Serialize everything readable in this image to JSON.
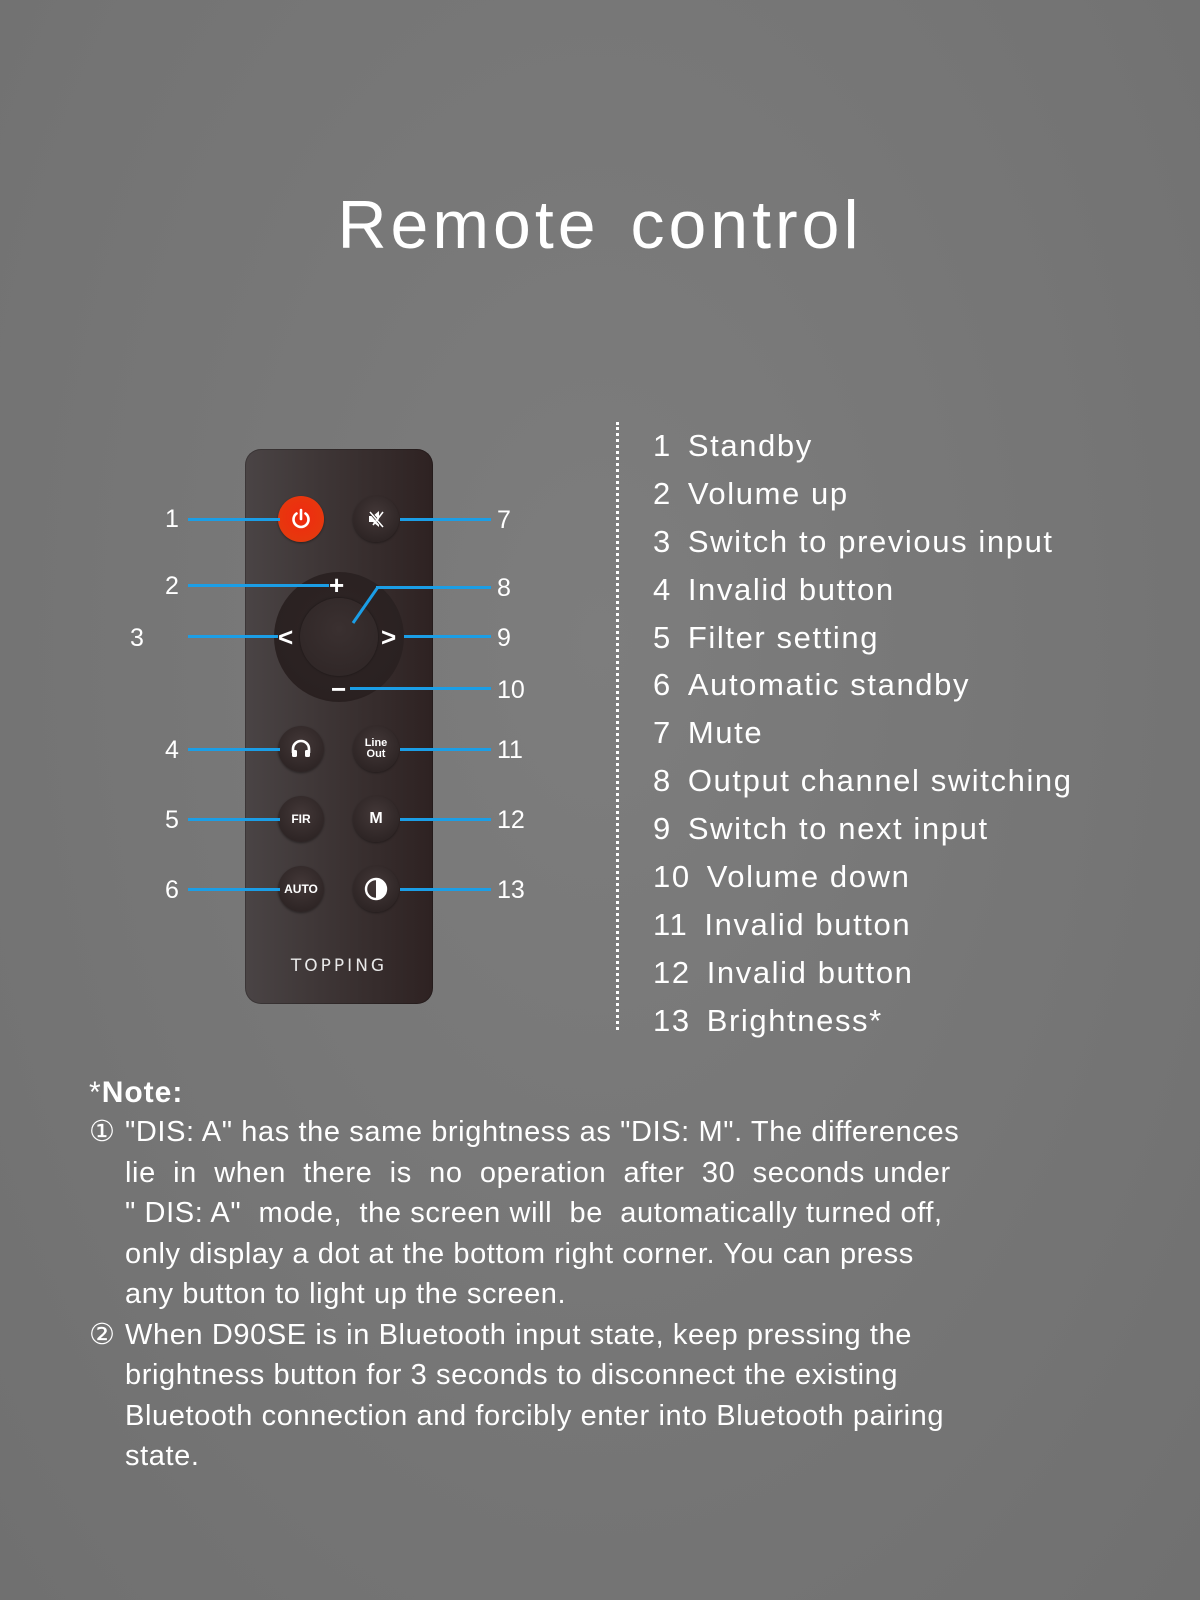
{
  "title": "Remote control",
  "remote": {
    "brand": "TOPPING",
    "accent_color": "#1b9ee6",
    "power_color": "#e8360e",
    "buttons": {
      "power_icon": "power-icon",
      "mute_icon": "mute-icon",
      "plus": "+",
      "minus": "−",
      "left": "<",
      "right": ">",
      "headphone_icon": "headphone-icon",
      "lineout_line1": "Line",
      "lineout_line2": "Out",
      "fir": "FIR",
      "m": "M",
      "auto": "AUTO",
      "brightness_icon": "half-circle-icon"
    },
    "callouts": {
      "c1": "1",
      "c2": "2",
      "c3": "3",
      "c4": "4",
      "c5": "5",
      "c6": "6",
      "c7": "7",
      "c8": "8",
      "c9": "9",
      "c10": "10",
      "c11": "11",
      "c12": "12",
      "c13": "13"
    }
  },
  "legend": [
    {
      "num": "1",
      "label": "Standby"
    },
    {
      "num": "2",
      "label": "Volume up"
    },
    {
      "num": "3",
      "label": "Switch to previous input"
    },
    {
      "num": "4",
      "label": "Invalid button"
    },
    {
      "num": "5",
      "label": "Filter setting"
    },
    {
      "num": "6",
      "label": "Automatic standby"
    },
    {
      "num": "7",
      "label": "Mute"
    },
    {
      "num": "8",
      "label": "Output channel switching"
    },
    {
      "num": "9",
      "label": "Switch to next input"
    },
    {
      "num": "10",
      "label": "Volume down"
    },
    {
      "num": "11",
      "label": "Invalid button"
    },
    {
      "num": "12",
      "label": "Invalid button"
    },
    {
      "num": "13",
      "label": "Brightness*"
    }
  ],
  "note": {
    "star": "*",
    "title": "Note:",
    "items": [
      {
        "mark": "①",
        "lines": [
          "\"DIS: A\" has the same brightness as \"DIS: M\". The differences",
          "lie  in  when  there  is  no  operation  after  30  seconds under",
          "\" DIS: A\"  mode,  the screen will  be  automatically turned off,",
          "only display a dot at the bottom right corner. You can press",
          "any button to light up the screen."
        ]
      },
      {
        "mark": "②",
        "lines": [
          "When D90SE is in Bluetooth input state, keep pressing the",
          "brightness button for 3 seconds to disconnect the existing",
          "Bluetooth connection and forcibly enter into Bluetooth pairing",
          "state."
        ]
      }
    ]
  }
}
